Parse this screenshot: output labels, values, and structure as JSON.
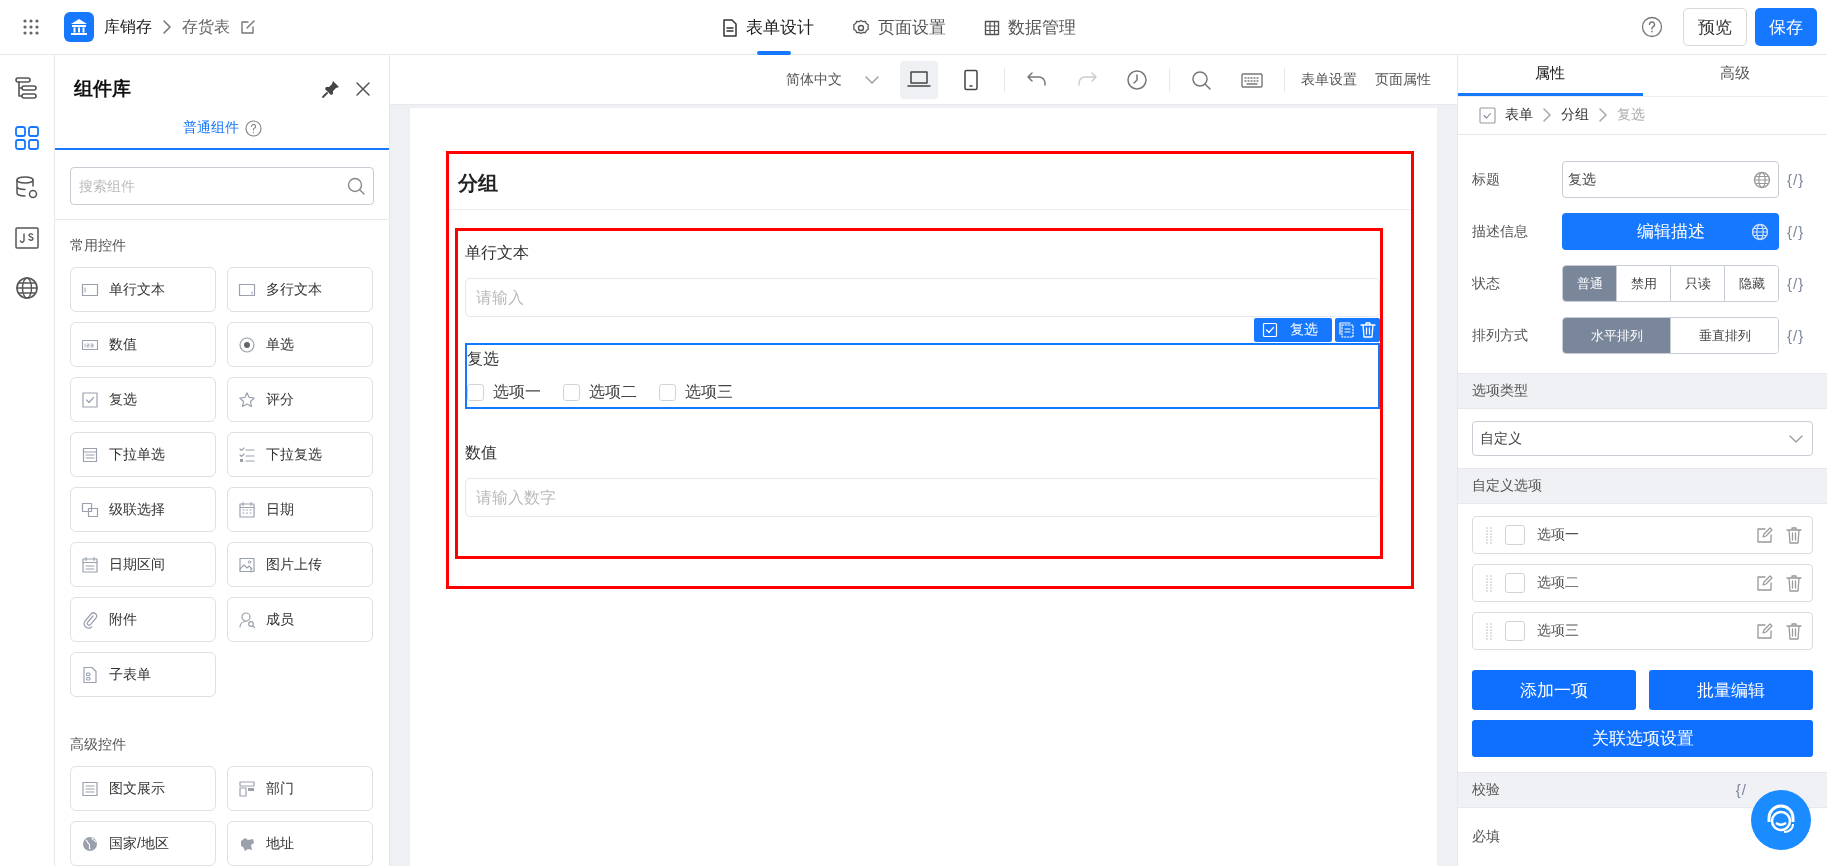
{
  "top_bar": {
    "app_name": "库销存",
    "page_name": "存货表",
    "nav_tabs": [
      {
        "label": "表单设计",
        "selected": true
      },
      {
        "label": "页面设置",
        "selected": false
      },
      {
        "label": "数据管理",
        "selected": false
      }
    ],
    "preview_button": "预览",
    "save_button": "保存"
  },
  "left_rail": [
    {
      "selected": false
    },
    {
      "selected": true
    },
    {
      "selected": false
    },
    {
      "selected": false
    },
    {
      "selected": false
    }
  ],
  "component_panel": {
    "title": "组件库",
    "tabs": [
      {
        "label": "普通组件",
        "selected": true
      }
    ],
    "search": {
      "placeholder": "搜索组件"
    },
    "groups": [
      {
        "title": "常用控件",
        "items": [
          {
            "label": "单行文本"
          },
          {
            "label": "多行文本"
          },
          {
            "label": "数值"
          },
          {
            "label": "单选"
          },
          {
            "label": "复选"
          },
          {
            "label": "评分"
          },
          {
            "label": "下拉单选"
          },
          {
            "label": "下拉复选"
          },
          {
            "label": "级联选择"
          },
          {
            "label": "日期"
          },
          {
            "label": "日期区间"
          },
          {
            "label": "图片上传"
          },
          {
            "label": "附件"
          },
          {
            "label": "成员"
          },
          {
            "label": "子表单"
          }
        ]
      },
      {
        "title": "高级控件",
        "items": [
          {
            "label": "图文展示"
          },
          {
            "label": "部门"
          },
          {
            "label": "国家/地区"
          },
          {
            "label": "地址"
          }
        ]
      }
    ]
  },
  "toolbar": {
    "language": "简体中文",
    "devices": [
      {
        "selected": true
      },
      {
        "selected": false
      }
    ],
    "links": [
      "表单设置",
      "页面属性"
    ]
  },
  "canvas": {
    "group_title": "分组",
    "fields": [
      {
        "kind": "input",
        "label": "单行文本",
        "placeholder": "请输入"
      },
      {
        "kind": "checkbox",
        "label": "复选",
        "selected": true,
        "tag": "复选",
        "options": [
          {
            "label": "选项一",
            "checked": false
          },
          {
            "label": "选项二",
            "checked": false
          },
          {
            "label": "选项三",
            "checked": false
          }
        ]
      },
      {
        "kind": "input",
        "label": "数值",
        "placeholder": "请输入数字"
      }
    ]
  },
  "properties": {
    "tabs": [
      {
        "label": "属性",
        "selected": true
      },
      {
        "label": "高级",
        "selected": false
      }
    ],
    "breadcrumb": [
      {
        "label": "表单",
        "current": false
      },
      {
        "label": "分组",
        "current": false
      },
      {
        "label": "复选",
        "current": true
      }
    ],
    "rows": [
      {
        "kind": "text",
        "label": "标题",
        "value": "复选",
        "binding": "{/}"
      },
      {
        "kind": "action",
        "label": "描述信息",
        "button": "编辑描述",
        "binding": "{/}"
      },
      {
        "kind": "segmented",
        "label": "状态",
        "options": [
          {
            "label": "普通",
            "selected": true
          },
          {
            "label": "禁用",
            "selected": false
          },
          {
            "label": "只读",
            "selected": false
          },
          {
            "label": "隐藏",
            "selected": false
          }
        ],
        "binding": "{/}"
      },
      {
        "kind": "segmented",
        "label": "排列方式",
        "options": [
          {
            "label": "水平排列",
            "selected": true
          },
          {
            "label": "垂直排列",
            "selected": false
          }
        ],
        "binding": "{/}"
      }
    ],
    "option_type": {
      "title": "选项类型",
      "value": "自定义"
    },
    "custom_options": {
      "title": "自定义选项",
      "items": [
        {
          "label": "选项一",
          "checked": false
        },
        {
          "label": "选项二",
          "checked": false
        },
        {
          "label": "选项三",
          "checked": false
        }
      ],
      "buttons": [
        "添加一项",
        "批量编辑"
      ],
      "link_button": "关联选项设置"
    },
    "validation": {
      "title": "校验",
      "binding": "{/",
      "required_label": "必填"
    }
  }
}
